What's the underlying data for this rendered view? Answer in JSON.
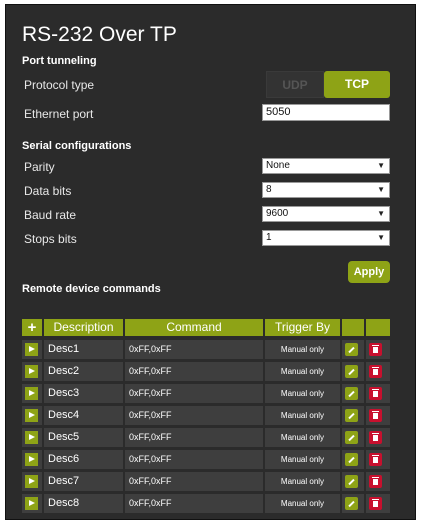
{
  "title": "RS-232 Over TP",
  "port_tunneling": {
    "heading": "Port tunneling",
    "protocol_label": "Protocol type",
    "protocol_options": [
      "UDP",
      "TCP"
    ],
    "protocol_selected": "TCP",
    "ethernet_label": "Ethernet port",
    "ethernet_value": "5050"
  },
  "serial": {
    "heading": "Serial configurations",
    "parity_label": "Parity",
    "parity_value": "None",
    "data_bits_label": "Data bits",
    "data_bits_value": "8",
    "baud_label": "Baud rate",
    "baud_value": "9600",
    "stop_bits_label": "Stops bits",
    "stop_bits_value": "1",
    "apply_label": "Apply"
  },
  "commands": {
    "heading": "Remote device commands",
    "add_label": "+",
    "columns": [
      "Description",
      "Command",
      "Trigger By"
    ],
    "rows": [
      {
        "desc": "Desc1",
        "command": "0xFF,0xFF",
        "trigger": "Manual only"
      },
      {
        "desc": "Desc2",
        "command": "0xFF,0xFF",
        "trigger": "Manual only"
      },
      {
        "desc": "Desc3",
        "command": "0xFF,0xFF",
        "trigger": "Manual only"
      },
      {
        "desc": "Desc4",
        "command": "0xFF,0xFF",
        "trigger": "Manual only"
      },
      {
        "desc": "Desc5",
        "command": "0xFF,0xFF",
        "trigger": "Manual only"
      },
      {
        "desc": "Desc6",
        "command": "0xFF,0xFF",
        "trigger": "Manual only"
      },
      {
        "desc": "Desc7",
        "command": "0xFF,0xFF",
        "trigger": "Manual only"
      },
      {
        "desc": "Desc8",
        "command": "0xFF,0xFF",
        "trigger": "Manual only"
      }
    ]
  },
  "colors": {
    "accent": "#8ea316",
    "delete": "#c8102e",
    "panel": "#2b2b2b"
  },
  "icons": {
    "run": "play-icon",
    "edit": "pencil-icon",
    "delete": "trash-icon",
    "dropdown": "caret-down-icon"
  }
}
